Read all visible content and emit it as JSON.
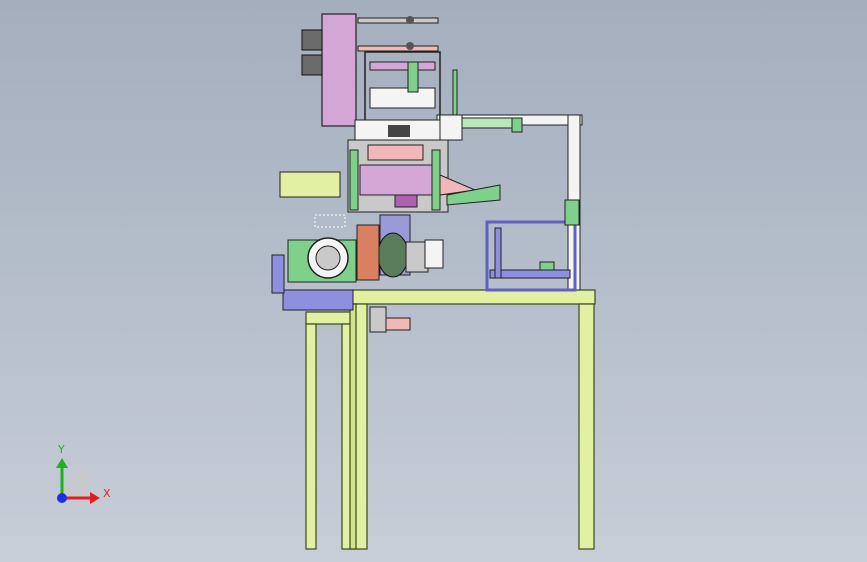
{
  "viewport": {
    "background_top": "#a4aebd",
    "background_bottom": "#c8ced8"
  },
  "colors": {
    "frame_fill": "#e2f0a4",
    "frame_stroke": "#3a4a1a",
    "part_magenta": "#d3a6d6",
    "part_pink": "#f0b8b8",
    "part_green": "#7fd08a",
    "part_blue": "#8f8fe0",
    "part_gray": "#c9c9c9",
    "part_white": "#f4f4f4",
    "line_dark": "#1c1c1c"
  },
  "triad": {
    "x_label": "X",
    "y_label": "Y",
    "x_color": "#e02020",
    "y_color": "#20b020",
    "z_color": "#2030e0"
  }
}
